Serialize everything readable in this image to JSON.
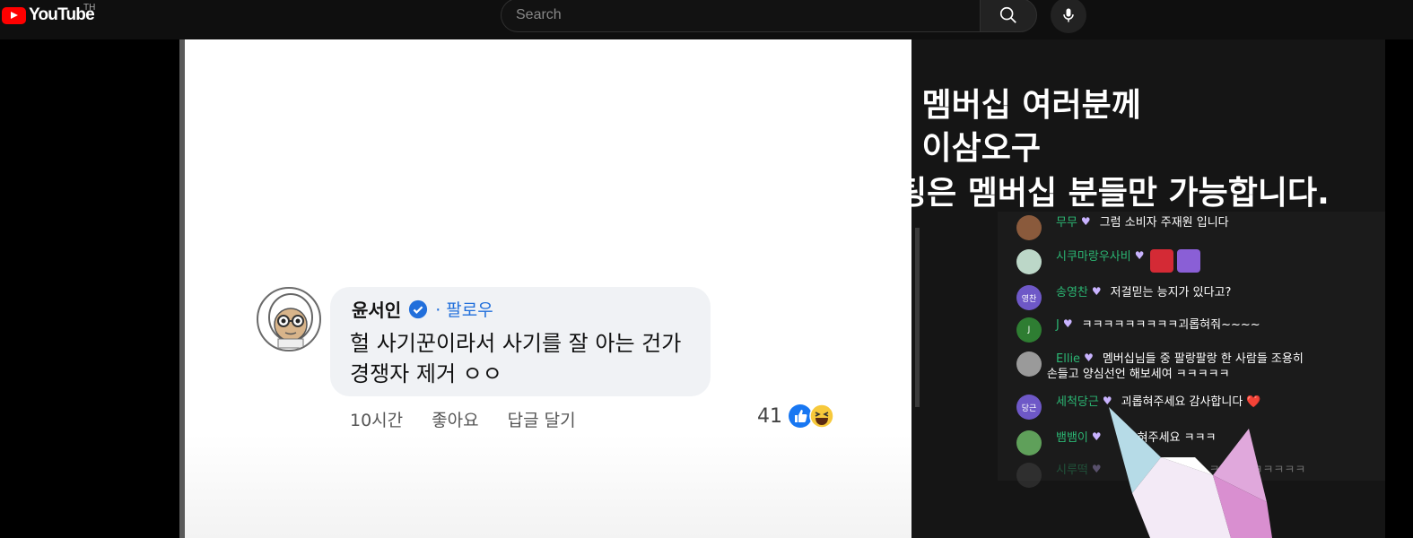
{
  "header": {
    "logo_text": "YouTube",
    "logo_country": "TH",
    "search_placeholder": "Search",
    "icons": [
      "youtube-logo-icon",
      "search-icon",
      "microphone-icon"
    ]
  },
  "video": {
    "comment": {
      "author": "윤서인",
      "follow_label": "· 팔로우",
      "text_line1": "헐 사기꾼이라서 사기를 잘 아는 건가",
      "text_line2": "경쟁자 제거 ㅇㅇ",
      "time": "10시간",
      "like_label": "좋아요",
      "reply_label": "답글 달기",
      "reaction_count": "41",
      "icons": [
        "verified-icon",
        "like-reaction-icon",
        "haha-reaction-icon"
      ]
    },
    "overlay": {
      "line1": "- 멤버십 여러분께",
      "line2": "- 이삼오구",
      "line3": "팅은 멤버십 분들만 가능합니다."
    },
    "chat": [
      {
        "avatar": "",
        "avatar_color": "#8a5a3c",
        "user": "무무",
        "user_color": "#2bb673",
        "message": "그럼 소비자 주재원 입니다"
      },
      {
        "avatar": "",
        "avatar_color": "#bcd7c8",
        "user": "시쿠마랑우사비",
        "user_color": "#2bb673",
        "message": ""
      },
      {
        "avatar": "영찬",
        "avatar_color": "#6e58c7",
        "user": "송영찬",
        "user_color": "#2bb673",
        "message": "저걸믿는 능지가 있다고?"
      },
      {
        "avatar": "J",
        "avatar_color": "#2e7d32",
        "user": "J",
        "user_color": "#2bb673",
        "message": "ㅋㅋㅋㅋㅋㅋㅋㅋㅋ괴롭혀줘~~~~"
      },
      {
        "avatar": "",
        "avatar_color": "#9a9a9a",
        "user": "Ellie",
        "user_color": "#2bb673",
        "message": "멤버십님들 중 팔랑팔랑 한 사람들 조용히",
        "message2": "손들고 양심선언 해보세여 ㅋㅋㅋㅋㅋ"
      },
      {
        "avatar": "당근",
        "avatar_color": "#6e58c7",
        "user": "세척당근",
        "user_color": "#2bb673",
        "message": "괴롭혀주세요 감사합니다 ❤️"
      },
      {
        "avatar": "",
        "avatar_color": "#5fa05a",
        "user": "뱀뱀이",
        "user_color": "#2bb673",
        "message": "혀주세요 ㅋㅋㅋ"
      },
      {
        "avatar": "",
        "avatar_color": "#555555",
        "user": "시루떡",
        "user_color": "#2bb673",
        "message": "ㅋㅋㅋㅋㅋㅋㅋㅋㅋ"
      }
    ],
    "colors": {
      "accent_red": "#ff0000",
      "link_blue": "#216fdb",
      "chat_green": "#2bb673"
    }
  }
}
